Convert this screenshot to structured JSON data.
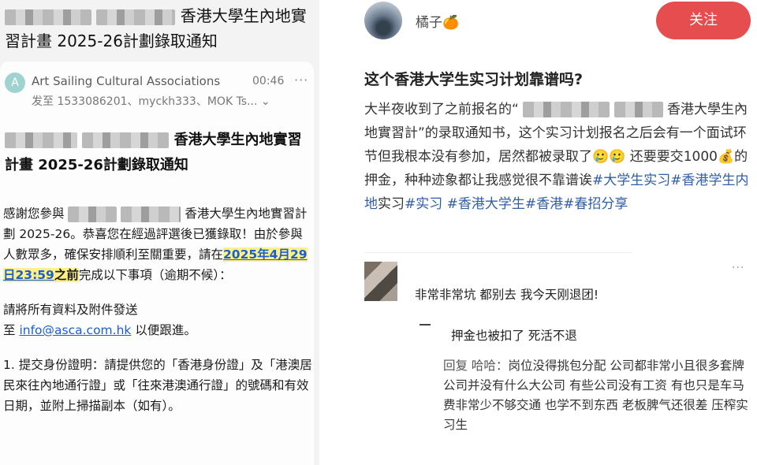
{
  "email": {
    "header_title": "香港大學生內地實習計畫 2025-26計劃錄取通知",
    "sender_initial": "A",
    "sender_name": "Art Sailing Cultural Associations",
    "time": "00:46",
    "more": "···",
    "to_line": "发至 1533086201、myckh333、MOK Ts... ⌄",
    "subject": "香港大學生內地實習計畫 2025-26計劃錄取通知",
    "para1_a": "感謝您參與",
    "para1_b": "香港大學生內地實習計劃 2025-26。恭喜您在經過評選後已獲錄取！由於參與人數眾多，確保安排順利至關重要，請在",
    "deadline": "2025年4月29日23:59",
    "deadline_suffix": "之前",
    "para1_c": "完成以下事項（逾期不候）：",
    "para2_a": "請將所有資料及附件發送",
    "para2_b": "至",
    "email_link": "info@asca.com.hk",
    "para2_c": "以便跟進。",
    "para3": "1. 提交身份證明：請提供您的「香港身份證」及「港澳居民來往內地通行證」或「往來港澳通行證」的號碼和有效日期，並附上掃描副本（如有）。"
  },
  "post": {
    "username": "橘子🍊",
    "follow_label": "关注",
    "title": "这个香港大学生实习计划靠谱吗?",
    "body_a": "大半夜收到了之前报名的“",
    "body_b": "香港大學生內地實習計”的录取通知书，这个实习计划报名之后会有一个面试环节但我根本没有参加，居然都被录取了🥲🥲 还要要交1000💰的押金，种种迹象都让我感觉很不靠谱诶",
    "tags": [
      "#大学生实习",
      "#香港学生内地",
      "实习",
      "#实习",
      "#香港大学生",
      "#香港",
      "#春招分享"
    ],
    "comment_more": "···",
    "comment": "非常非常坑 都别去 我今天刚退团!",
    "reply1": "押金也被扣了 死活不退",
    "reply2_prefix": "回复 哈哈：",
    "reply2": "岗位没得挑包分配 公司都非常小且很多套牌公司并没有什么大公司 有些公司没有工资 有也只是车马费非常少不够交通 也学不到东西 老板脾气还很差 压榨实习生"
  }
}
